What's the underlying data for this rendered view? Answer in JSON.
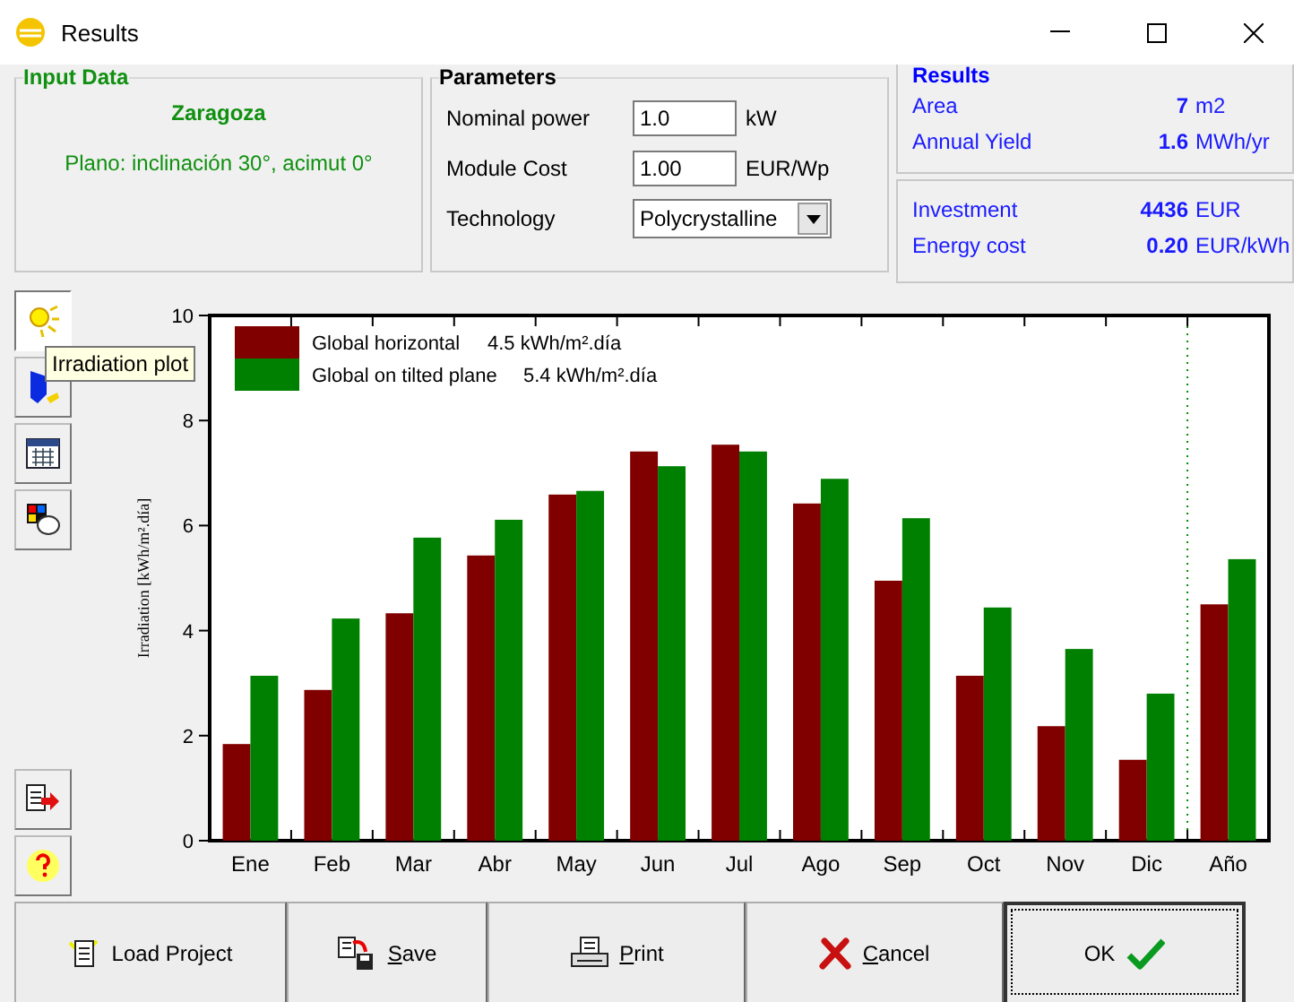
{
  "window": {
    "title": "Results"
  },
  "input_data": {
    "title": "Input Data",
    "location": "Zaragoza",
    "plane": "Plano: inclinación 30°, acimut 0°"
  },
  "parameters": {
    "title": "Parameters",
    "fields": [
      {
        "kind": "input",
        "label": "Nominal power",
        "value": "1.0",
        "unit": "kW"
      },
      {
        "kind": "input",
        "label": "Module Cost",
        "value": "1.00",
        "unit": "EUR/Wp"
      },
      {
        "kind": "select",
        "label": "Technology",
        "value": "Polycrystalline"
      }
    ]
  },
  "results": {
    "title": "Results",
    "groups": [
      [
        {
          "label": "Area",
          "value": "7",
          "unit": "m2"
        },
        {
          "label": "Annual Yield",
          "value": "1.6",
          "unit": "MWh/yr"
        }
      ],
      [
        {
          "label": "Investment",
          "value": "4436",
          "unit": "EUR"
        },
        {
          "label": "Energy cost",
          "value": "0.20",
          "unit": "EUR/kWh"
        }
      ]
    ]
  },
  "toolbar": {
    "tooltip": "Irradiation plot",
    "tools": [
      {
        "kind": "sun",
        "selected": true
      },
      {
        "kind": "shield",
        "selected": false
      },
      {
        "kind": "calendar",
        "selected": false
      },
      {
        "kind": "palette",
        "selected": false
      }
    ],
    "bottom_tools": [
      {
        "kind": "export"
      },
      {
        "kind": "help"
      }
    ]
  },
  "chart": {
    "legend_values": [
      "4.5 kWh/m².día",
      "5.4 kWh/m².día"
    ],
    "chart_data": {
      "type": "bar",
      "ylabel": "Irradiation [kWh/m².día]",
      "categories": [
        "Ene",
        "Feb",
        "Mar",
        "Abr",
        "May",
        "Jun",
        "Jul",
        "Ago",
        "Sep",
        "Oct",
        "Nov",
        "Dic",
        "Año"
      ],
      "ylim": [
        0,
        10
      ],
      "legend": "upper left",
      "yticks": [
        0,
        2,
        4,
        6,
        8,
        10
      ],
      "series": [
        {
          "name": "Global horizontal",
          "color": "#800000",
          "values": [
            1.84,
            2.87,
            4.33,
            5.43,
            6.59,
            7.41,
            7.54,
            6.42,
            4.95,
            3.14,
            2.18,
            1.54,
            4.5
          ]
        },
        {
          "name": "Global on tilted plane",
          "color": "#008000",
          "values": [
            3.14,
            4.23,
            5.77,
            6.11,
            6.66,
            7.13,
            7.41,
            6.89,
            6.14,
            4.44,
            3.65,
            2.8,
            5.36
          ]
        }
      ]
    }
  },
  "buttons": [
    {
      "kind": "load",
      "label": "Load Project",
      "underline_first": false,
      "focused": false
    },
    {
      "kind": "save",
      "label": "Save",
      "underline_first": true,
      "focused": false
    },
    {
      "kind": "print",
      "label": "Print",
      "underline_first": true,
      "focused": false
    },
    {
      "kind": "cancel",
      "label": "Cancel",
      "underline_first": true,
      "focused": false
    },
    {
      "kind": "ok",
      "label": "OK",
      "underline_first": false,
      "focused": true
    }
  ]
}
